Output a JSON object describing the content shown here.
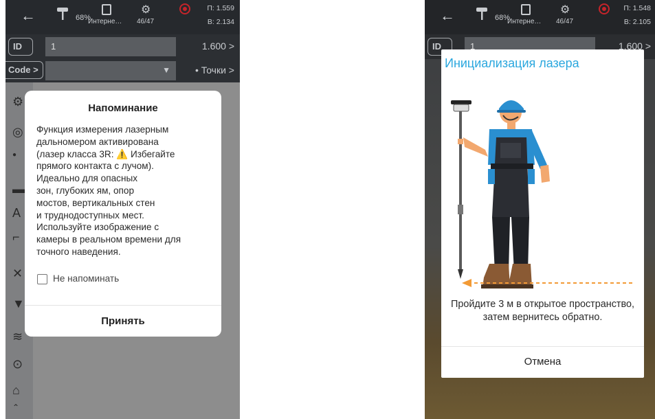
{
  "screen1": {
    "status": {
      "battery": "68%",
      "sim_label": "Интерне…",
      "satellites": "46/47",
      "coord_p": "П: 1.559",
      "coord_v": "В: 2.134"
    },
    "id_tag": "ID",
    "id_value": "1",
    "antenna_height": "1.600 >",
    "code_tag": "Code >",
    "code_value": "▼",
    "points_label": "• Точки >",
    "dialog": {
      "title": "Напоминание",
      "body": "Функция измерения лазерным\nдальномером активирована\n(лазер класса 3R: ⚠️ Избегайте\nпрямого контакта с лучом).\nИдеально для опасных\nзон, глубоких ям, опор\nмостов, вертикальных стен\nи труднодоступных мест.\nИспользуйте изображение с\nкамеры в реальном времени для\nточного наведения.",
      "checkbox_label": "Не напоминать",
      "accept_label": "Принять"
    }
  },
  "screen2": {
    "status": {
      "battery": "68%",
      "sim_label": "Интерне…",
      "satellites": "46/47",
      "coord_p": "П: 1.548",
      "coord_v": "В: 2.105"
    },
    "id_value": "1",
    "antenna_height": "1.600 >",
    "dialog": {
      "title": "Инициализация лазера",
      "message": "Пройдите 3 м в открытое пространство, затем вернитесь обратно.",
      "cancel_label": "Отмена"
    }
  },
  "colors": {
    "accent_title": "#2aa7de",
    "arrow": "#f29a35",
    "record": "#c6242a"
  }
}
